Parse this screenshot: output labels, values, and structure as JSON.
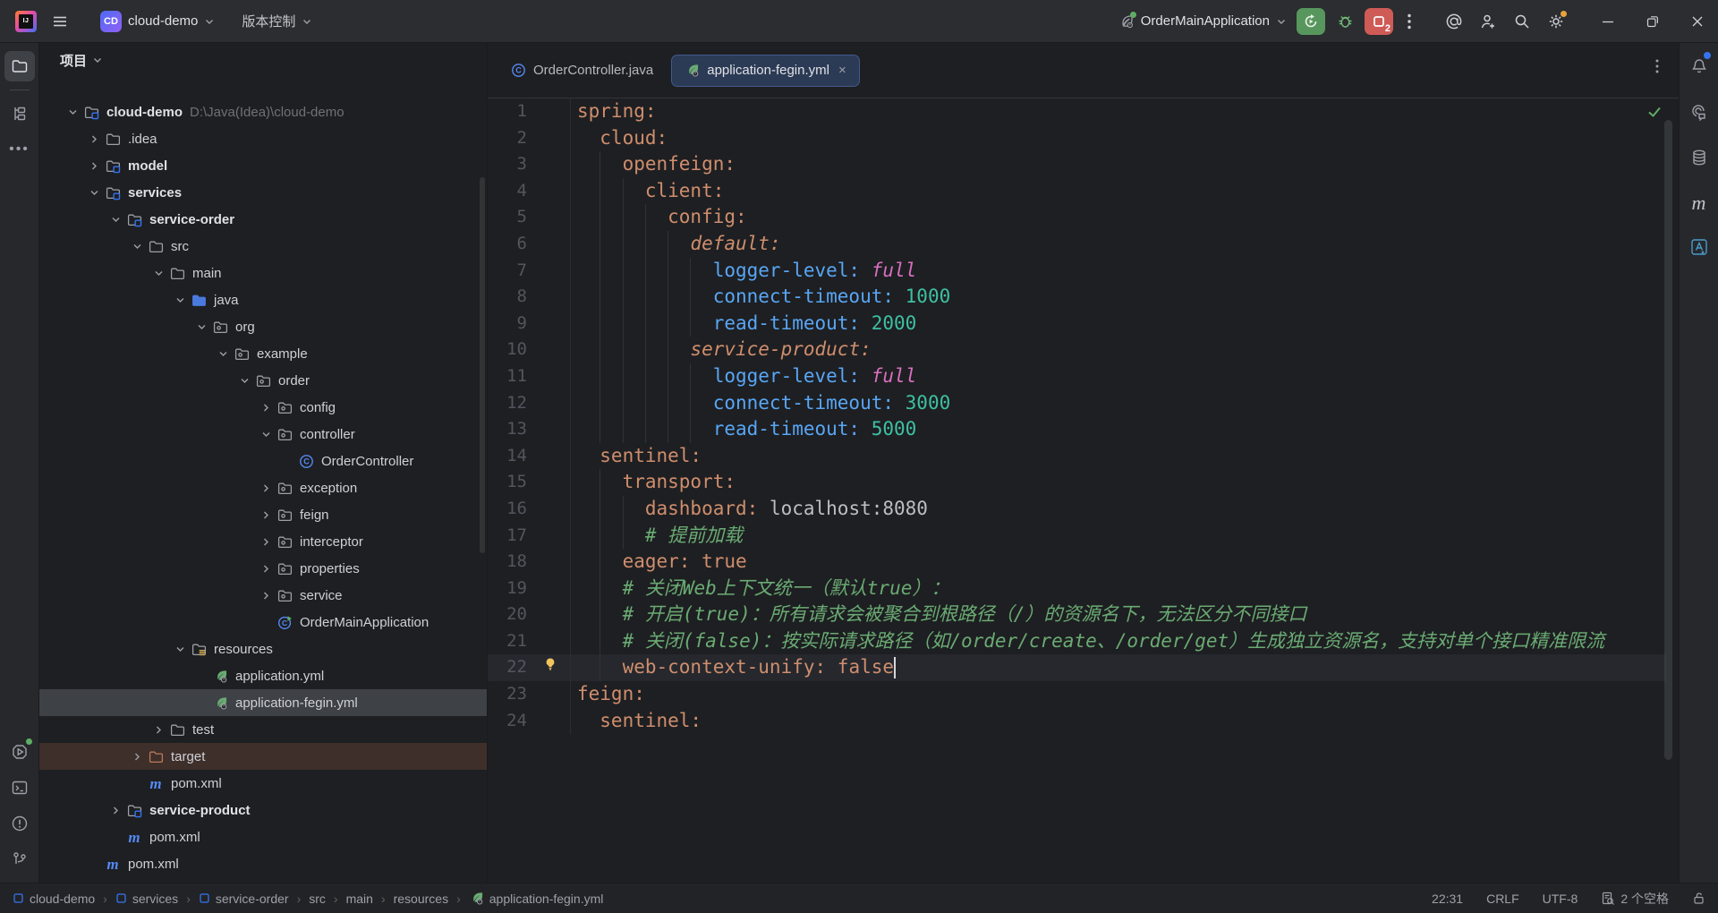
{
  "topbar": {
    "project": {
      "badge": "CD",
      "name": "cloud-demo"
    },
    "vcs_label": "版本控制",
    "run": {
      "config_name": "OrderMainApplication",
      "stop_count": "2"
    }
  },
  "project_panel": {
    "title": "项目",
    "tree": [
      {
        "label": "cloud-demo",
        "suffix": "D:\\Java(Idea)\\cloud-demo",
        "level": 0,
        "chevron": "open",
        "icon": "module-folder",
        "bold": true
      },
      {
        "label": ".idea",
        "level": 1,
        "chevron": "closed",
        "icon": "folder"
      },
      {
        "label": "model",
        "level": 1,
        "chevron": "closed",
        "icon": "module-folder",
        "bold": true
      },
      {
        "label": "services",
        "level": 1,
        "chevron": "open",
        "icon": "module-folder",
        "bold": true
      },
      {
        "label": "service-order",
        "level": 2,
        "chevron": "open",
        "icon": "module-folder",
        "bold": true
      },
      {
        "label": "src",
        "level": 3,
        "chevron": "open",
        "icon": "folder"
      },
      {
        "label": "main",
        "level": 4,
        "chevron": "open",
        "icon": "folder"
      },
      {
        "label": "java",
        "level": 5,
        "chevron": "open",
        "icon": "sources-folder"
      },
      {
        "label": "org",
        "level": 6,
        "chevron": "open",
        "icon": "package"
      },
      {
        "label": "example",
        "level": 7,
        "chevron": "open",
        "icon": "package"
      },
      {
        "label": "order",
        "level": 8,
        "chevron": "open",
        "icon": "package"
      },
      {
        "label": "config",
        "level": 9,
        "chevron": "closed",
        "icon": "package"
      },
      {
        "label": "controller",
        "level": 9,
        "chevron": "open",
        "icon": "package"
      },
      {
        "label": "OrderController",
        "level": 10,
        "chevron": null,
        "icon": "class"
      },
      {
        "label": "exception",
        "level": 9,
        "chevron": "closed",
        "icon": "package"
      },
      {
        "label": "feign",
        "level": 9,
        "chevron": "closed",
        "icon": "package"
      },
      {
        "label": "interceptor",
        "level": 9,
        "chevron": "closed",
        "icon": "package"
      },
      {
        "label": "properties",
        "level": 9,
        "chevron": "closed",
        "icon": "package"
      },
      {
        "label": "service",
        "level": 9,
        "chevron": "closed",
        "icon": "package"
      },
      {
        "label": "OrderMainApplication",
        "level": 9,
        "chevron": null,
        "icon": "class-run"
      },
      {
        "label": "resources",
        "level": 5,
        "chevron": "open",
        "icon": "resources-folder"
      },
      {
        "label": "application.yml",
        "level": 6,
        "chevron": null,
        "icon": "spring"
      },
      {
        "label": "application-fegin.yml",
        "level": 6,
        "chevron": null,
        "icon": "spring",
        "selected": true
      },
      {
        "label": "test",
        "level": 4,
        "chevron": "closed",
        "icon": "folder"
      },
      {
        "label": "target",
        "level": 3,
        "chevron": "closed",
        "icon": "excluded-folder",
        "highlight": true
      },
      {
        "label": "pom.xml",
        "level": 3,
        "chevron": null,
        "icon": "maven"
      },
      {
        "label": "service-product",
        "level": 2,
        "chevron": "closed",
        "icon": "module-folder",
        "bold": true
      },
      {
        "label": "pom.xml",
        "level": 2,
        "chevron": null,
        "icon": "maven"
      },
      {
        "label": "pom.xml",
        "level": 1,
        "chevron": null,
        "icon": "maven"
      }
    ]
  },
  "editor": {
    "tabs": [
      {
        "label": "OrderController.java",
        "icon": "class",
        "active": false,
        "closable": false
      },
      {
        "label": "application-fegin.yml",
        "icon": "spring",
        "active": true,
        "closable": true,
        "close_glyph": "×"
      }
    ],
    "lines": [
      {
        "n": 1,
        "seg": [
          {
            "t": "spring:",
            "c": "k"
          }
        ]
      },
      {
        "n": 2,
        "seg": [
          {
            "t": "  cloud:",
            "c": "k"
          }
        ]
      },
      {
        "n": 3,
        "seg": [
          {
            "t": "    openfeign:",
            "c": "k"
          }
        ]
      },
      {
        "n": 4,
        "seg": [
          {
            "t": "      client:",
            "c": "k"
          }
        ]
      },
      {
        "n": 5,
        "seg": [
          {
            "t": "        config:",
            "c": "k"
          }
        ]
      },
      {
        "n": 6,
        "seg": [
          {
            "t": "          ",
            "c": "p"
          },
          {
            "t": "default:",
            "c": "ki"
          }
        ]
      },
      {
        "n": 7,
        "seg": [
          {
            "t": "            logger-level: ",
            "c": "b"
          },
          {
            "t": "full",
            "c": "s"
          }
        ]
      },
      {
        "n": 8,
        "seg": [
          {
            "t": "            connect-timeout: ",
            "c": "b"
          },
          {
            "t": "1000",
            "c": "n"
          }
        ]
      },
      {
        "n": 9,
        "seg": [
          {
            "t": "            read-timeout: ",
            "c": "b"
          },
          {
            "t": "2000",
            "c": "n"
          }
        ]
      },
      {
        "n": 10,
        "seg": [
          {
            "t": "          ",
            "c": "p"
          },
          {
            "t": "service-product:",
            "c": "ki"
          }
        ]
      },
      {
        "n": 11,
        "seg": [
          {
            "t": "            logger-level: ",
            "c": "b"
          },
          {
            "t": "full",
            "c": "s"
          }
        ]
      },
      {
        "n": 12,
        "seg": [
          {
            "t": "            connect-timeout: ",
            "c": "b"
          },
          {
            "t": "3000",
            "c": "n"
          }
        ]
      },
      {
        "n": 13,
        "seg": [
          {
            "t": "            read-timeout: ",
            "c": "b"
          },
          {
            "t": "5000",
            "c": "n"
          }
        ]
      },
      {
        "n": 14,
        "seg": [
          {
            "t": "  sentinel:",
            "c": "k"
          }
        ]
      },
      {
        "n": 15,
        "seg": [
          {
            "t": "    transport:",
            "c": "k"
          }
        ]
      },
      {
        "n": 16,
        "seg": [
          {
            "t": "      dashboard: ",
            "c": "k"
          },
          {
            "t": "localhost:8080",
            "c": "p"
          }
        ]
      },
      {
        "n": 17,
        "seg": [
          {
            "t": "      ",
            "c": "p"
          },
          {
            "t": "# 提前加载",
            "c": "c"
          }
        ]
      },
      {
        "n": 18,
        "seg": [
          {
            "t": "    eager: ",
            "c": "k"
          },
          {
            "t": "true",
            "c": "k"
          }
        ]
      },
      {
        "n": 19,
        "seg": [
          {
            "t": "    ",
            "c": "p"
          },
          {
            "t": "# 关闭Web上下文统一（默认true）：",
            "c": "c"
          }
        ]
      },
      {
        "n": 20,
        "seg": [
          {
            "t": "    ",
            "c": "p"
          },
          {
            "t": "# 开启(true)：所有请求会被聚合到根路径（/）的资源名下，无法区分不同接口",
            "c": "c"
          }
        ]
      },
      {
        "n": 21,
        "seg": [
          {
            "t": "    ",
            "c": "p"
          },
          {
            "t": "# 关闭(false)：按实际请求路径（如/order/create、/order/get）生成独立资源名，支持对单个接口精准限流",
            "c": "c"
          }
        ]
      },
      {
        "n": 22,
        "seg": [
          {
            "t": "    web-context-unify: ",
            "c": "k"
          },
          {
            "t": "false",
            "c": "k"
          }
        ],
        "caret": true,
        "bulb": true,
        "current": true
      },
      {
        "n": 23,
        "seg": [
          {
            "t": "feign:",
            "c": "k"
          }
        ]
      },
      {
        "n": 24,
        "seg": [
          {
            "t": "  sentinel:",
            "c": "k"
          }
        ]
      }
    ]
  },
  "statusbar": {
    "breadcrumbs": [
      {
        "label": "cloud-demo",
        "icon": "module"
      },
      {
        "label": "services",
        "icon": "module"
      },
      {
        "label": "service-order",
        "icon": "module"
      },
      {
        "label": "src"
      },
      {
        "label": "main"
      },
      {
        "label": "resources"
      },
      {
        "label": "application-fegin.yml",
        "icon": "spring"
      }
    ],
    "caret_position": "22:31",
    "line_separator": "CRLF",
    "encoding": "UTF-8",
    "indent_info": "2 个空格"
  },
  "colors": {
    "accent_blue": "#3574f0",
    "run_green": "#57965c",
    "stop_red": "#cf5b56",
    "yaml_key_orange": "#cf8e6d",
    "yaml_key_blue": "#58a6f5",
    "yaml_number_teal": "#3dc0a3",
    "yaml_value_pink": "#d86fc0",
    "comment_green": "#6aab73",
    "selection_gray": "#3e4146",
    "excluded_brown": "#3e2f2a"
  }
}
